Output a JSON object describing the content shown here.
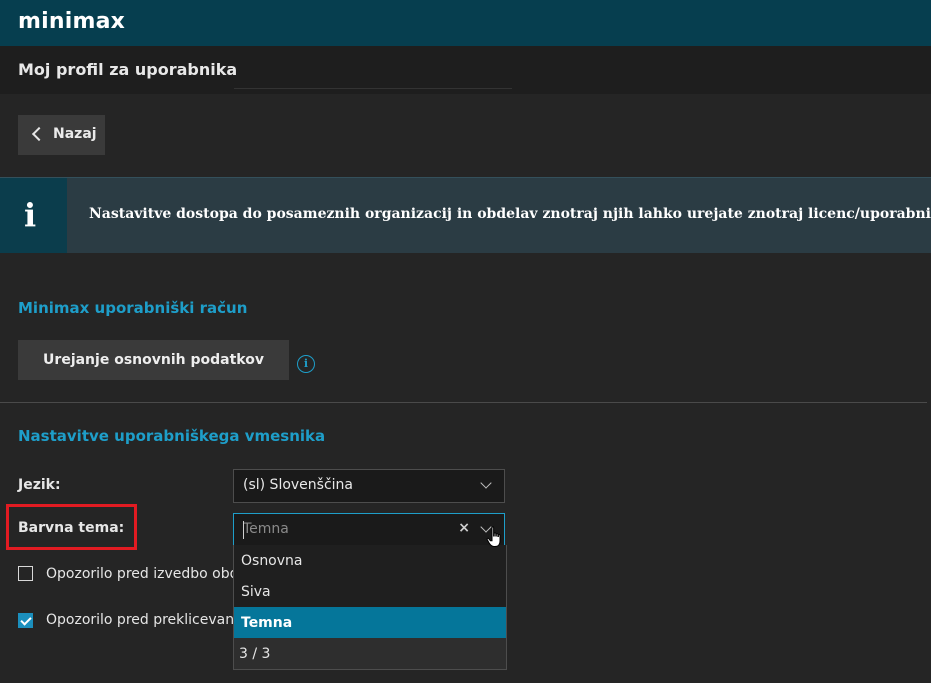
{
  "app": {
    "logo": "minimax",
    "page_title": "Moj profil za uporabnika"
  },
  "toolbar": {
    "back_label": "Nazaj"
  },
  "info_banner": {
    "icon": "info-icon",
    "message": "Nastavitve dostopa do posameznih organizacij in obdelav znotraj njih lahko urejate znotraj licenc/uporabnikov."
  },
  "account_section": {
    "title": "Minimax uporabniški račun",
    "edit_button_label": "Urejanje osnovnih podatkov",
    "info_icon": "i"
  },
  "ui_section": {
    "title": "Nastavitve uporabniškega vmesnika",
    "language": {
      "label": "Jezik:",
      "value": "(sl) Slovenščina"
    },
    "theme": {
      "label": "Barvna tema:",
      "placeholder": "Temna",
      "clear": "×",
      "options": [
        {
          "label": "Osnovna",
          "selected": false
        },
        {
          "label": "Siva",
          "selected": false
        },
        {
          "label": "Temna",
          "selected": true
        }
      ],
      "counter": "3 / 3"
    },
    "checkboxes": [
      {
        "label": "Opozorilo pred izvedbo obd",
        "checked": false
      },
      {
        "label": "Opozorilo pred preklicevanje",
        "checked": true
      }
    ]
  },
  "colors": {
    "topbar": "#063e4f",
    "accent": "#1e9ec9",
    "selected_option": "#05769a",
    "highlight_border": "#e21b22"
  }
}
